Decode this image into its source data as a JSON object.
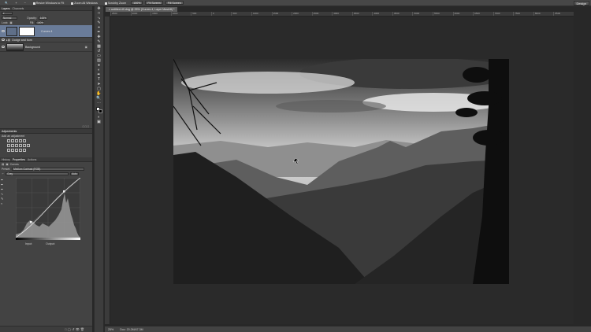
{
  "options_bar": {
    "resize_windows": "Resize Windows to Fit",
    "zoom_all_windows": "Zoom All Windows",
    "scrubby_zoom": "Scrubby Zoom",
    "zoom_percent": "100%",
    "fit_screen": "Fit Screen",
    "fill_screen": "Fill Screen",
    "workspace": "Design"
  },
  "layers_panel": {
    "tabs": [
      "Layers",
      "Channels"
    ],
    "blend_mode": "Normal",
    "opacity_label": "Opacity:",
    "opacity_value": "100%",
    "lock_label": "Lock:",
    "fill_label": "Fill:",
    "fill_value": "100%",
    "layers": [
      {
        "name": "Curves 4",
        "selected": true
      },
      {
        "name": "Dodge and burn",
        "selected": false
      },
      {
        "name": "Background",
        "selected": false
      }
    ]
  },
  "adjustments_panel": {
    "tab": "Adjustments",
    "title": "Add an adjustment"
  },
  "properties_panel": {
    "tabs": [
      "History",
      "Properties",
      "Actions"
    ],
    "title": "Curves",
    "preset_label": "Preset:",
    "preset_value": "Medium Contrast (RGB)",
    "channel_value": "Gray",
    "auto_label": "Auto",
    "input_label": "Input:",
    "output_label": "Output:"
  },
  "document": {
    "tab_title": "untitled-40.dng @ 25% (Curves 4, Layer Mask/8) *",
    "zoom": "25%",
    "doc_size": "Doc: 20.2M/47.3M",
    "ruler_ticks": [
      "2500",
      "2000",
      "1500",
      "1000",
      "500",
      "0",
      "500",
      "1000",
      "1500",
      "2000",
      "2500",
      "3000",
      "3500",
      "4000",
      "4500",
      "5000",
      "5500",
      "6000",
      "6500",
      "7000",
      "7500",
      "8000",
      "8500"
    ]
  },
  "icons": [
    "eye-icon",
    "lock-icon",
    "folder-icon",
    "move-tool-icon",
    "marquee-tool-icon",
    "lasso-tool-icon",
    "crop-tool-icon",
    "brush-tool-icon",
    "zoom-tool-icon",
    "hand-tool-icon"
  ],
  "colors": {
    "selected_layer": "#6a7c99",
    "panel_bg": "#434343",
    "canvas_bg": "#282828"
  }
}
